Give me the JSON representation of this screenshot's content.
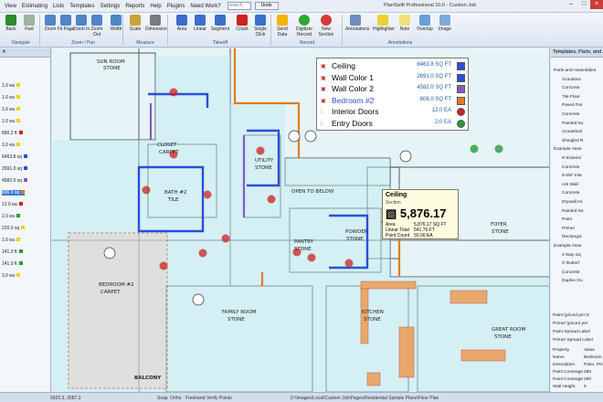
{
  "app": {
    "title": "PlanSwift Professional 10.0 - Custom Job",
    "menu": [
      "View",
      "Estimating",
      "Lists",
      "Templates",
      "Settings",
      "Reports",
      "Help",
      "Plugins",
      "Need Work?"
    ],
    "search_placeholder": "search",
    "undo_label": "Undo"
  },
  "ribbon": {
    "buttons": [
      "Back",
      "Fwd",
      "Zoom",
      "Fit Page",
      "Zoom In",
      "Zoom Out",
      "Width",
      "Scale",
      "Dimension",
      "Area",
      "Linear",
      "Segment",
      "Count",
      "Single Click",
      "Send Data",
      "Digitizer Record",
      "New Section",
      "Annotations",
      "Highlighter",
      "Note",
      "Overlap",
      "Image"
    ],
    "groups": [
      "Navigate",
      "Zoom / Pan",
      "Measure",
      "Takeoff",
      "Record",
      "Annotations"
    ]
  },
  "left_panel": {
    "rows": [
      {
        "label": "1.0 ea",
        "color": "#e8d21f"
      },
      {
        "label": "1.0 ea",
        "color": "#e8d21f"
      },
      {
        "label": "1.0 ea",
        "color": "#e8d21f"
      },
      {
        "label": "1.0 ea",
        "color": "#e8d21f"
      },
      {
        "label": "890.2 ft",
        "color": "#c22"
      },
      {
        "label": "1.0 ea",
        "color": "#e8d21f"
      },
      {
        "label": "6463.8 sq",
        "color": "#2a4fd8"
      },
      {
        "label": "2691.0 sq",
        "color": "#2a4fd8"
      },
      {
        "label": "4582.0 sq",
        "color": "#8a5bbd"
      },
      {
        "label": "806.0 sq",
        "color": "#e07b1f"
      },
      {
        "label": "12.0 ea",
        "color": "#c22"
      },
      {
        "label": "2.0 ea",
        "color": "#2a9b3a"
      },
      {
        "label": "220.0 sq",
        "color": "#e8d21f"
      },
      {
        "label": "1.0 ea",
        "color": "#e8d21f"
      },
      {
        "label": "141.0 ft",
        "color": "#2a9b3a"
      },
      {
        "label": "141.0 ft",
        "color": "#2a9b3a"
      },
      {
        "label": "1.0 ea",
        "color": "#e8d21f"
      }
    ]
  },
  "legend": {
    "items": [
      {
        "name": "Ceiling",
        "value": "6463.8 SQ FT",
        "color": "#2a4fd8"
      },
      {
        "name": "Wall Color 1",
        "value": "2691.0 SQ FT",
        "color": "#2a4fd8"
      },
      {
        "name": "Wall Color 2",
        "value": "4582.0 SQ FT",
        "color": "#8a5bbd"
      },
      {
        "name": "Bedroom #2",
        "value": "806.0 SQ FT",
        "color": "#e07b1f"
      },
      {
        "name": "Interior Doors",
        "value": "12.0 EA",
        "color": "#c22"
      },
      {
        "name": "Entry Doors",
        "value": "2.0 EA",
        "color": "#2a9b3a"
      }
    ]
  },
  "tooltip": {
    "title": "Ceiling",
    "subtitle": "Section",
    "total": "5,876.17",
    "rows": [
      {
        "label": "Area",
        "value": "5,876.17 SQ FT"
      },
      {
        "label": "Linear Total",
        "value": "541.76 FT"
      },
      {
        "label": "Point Count",
        "value": "50.00 EA"
      }
    ]
  },
  "rooms": [
    "SUN ROOM",
    "STONE",
    "CLOSET",
    "CARPET",
    "BATH #2",
    "TILE",
    "UTILITY",
    "STONE",
    "OPEN TO BELOW",
    "PANTRY",
    "STONE",
    "POWDER",
    "STONE",
    "FOYER",
    "STONE",
    "BEDROOM #2",
    "CARPET",
    "FAMILY ROOM",
    "STONE",
    "KITCHEN",
    "STONE",
    "GREAT ROOM",
    "STONE",
    "BALCONY"
  ],
  "right_panel": {
    "title": "Templates, Parts, and Assemblies",
    "rows": [
      "Parts and Assemblies",
      "Acoustica",
      "Concrete",
      "Tile Floor",
      "Paved Par",
      "Concrete",
      "Painted Su",
      "Acoustical",
      "Shingled R",
      "Example Asse",
      "8' Exterior",
      "Concrete",
      "5-5/8\" Inte",
      "Ark Wall",
      "Concrete",
      "Drywall As",
      "Painted Su",
      "Paint",
      "Primer",
      "Rectangul",
      "Example Asse",
      "4 Way Sq",
      "3' Butterf",
      "Concrete",
      "Duplex Ou"
    ],
    "props": [
      {
        "name": "Property",
        "value": "Value"
      },
      {
        "name": "Name",
        "value": "Bedroom #"
      },
      {
        "name": "Description",
        "value": "Paint, Prim"
      },
      {
        "name": "Paint Coverage",
        "value": "280"
      },
      {
        "name": "Paint Coverage",
        "value": "280"
      },
      {
        "name": "Wall Height",
        "value": "9"
      }
    ],
    "paint_items": [
      "Paint (priced per G",
      "Primer (priced per",
      "Paint Spread Label",
      "Primer Spread Label"
    ]
  },
  "status": {
    "coords": "5925.3, 3587.3",
    "snap": "Snap",
    "ortho": "Ortho",
    "freehand": "Freehand",
    "verify": "Verify Points",
    "path": "D:\\Images\\Local\\Custom Job\\Pages\\Residential Sample Plans\\Floor Plan"
  }
}
